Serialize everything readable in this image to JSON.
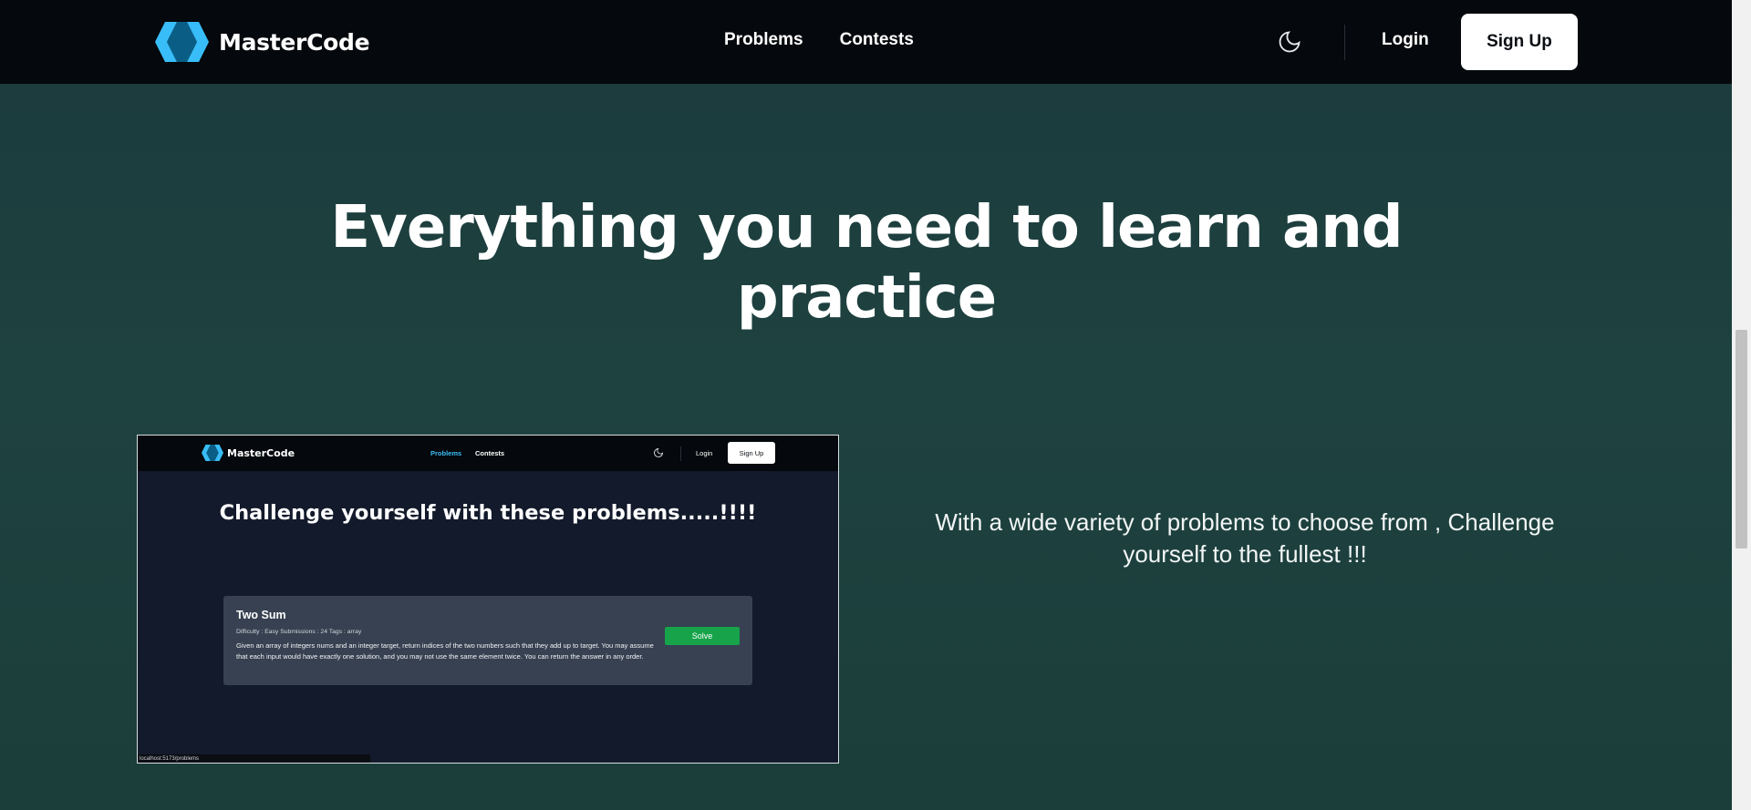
{
  "navbar": {
    "brand": "MasterCode",
    "links": [
      "Problems",
      "Contests"
    ],
    "login": "Login",
    "signup": "Sign Up",
    "icons": {
      "logo": "mastercode-logo",
      "theme": "moon-icon"
    }
  },
  "section": {
    "heading": "Everything you need to learn and practice",
    "description": "With a wide variety of problems to choose from , Challenge yourself to the fullest !!!"
  },
  "preview": {
    "brand": "MasterCode",
    "links": [
      "Problems",
      "Contests"
    ],
    "active_link_color": "#38bdf8",
    "login": "Login",
    "signup": "Sign Up",
    "heading": "Challenge yourself with these problems.....!!!!",
    "problem": {
      "title": "Two Sum",
      "meta": "Difficulty : Easy  Submissions : 24  Tags : array",
      "description": "Given an array of integers nums and an integer target, return indices of the two numbers such that they add up to target. You may assume that each input would have exactly one solution, and you may not use the same element twice. You can return the answer in any order.",
      "button": "Solve"
    },
    "status_url": "localhost:5173/problems"
  },
  "colors": {
    "accent": "#38bdf8",
    "solve": "#16a34a",
    "navbar_bg": "#05080c"
  }
}
